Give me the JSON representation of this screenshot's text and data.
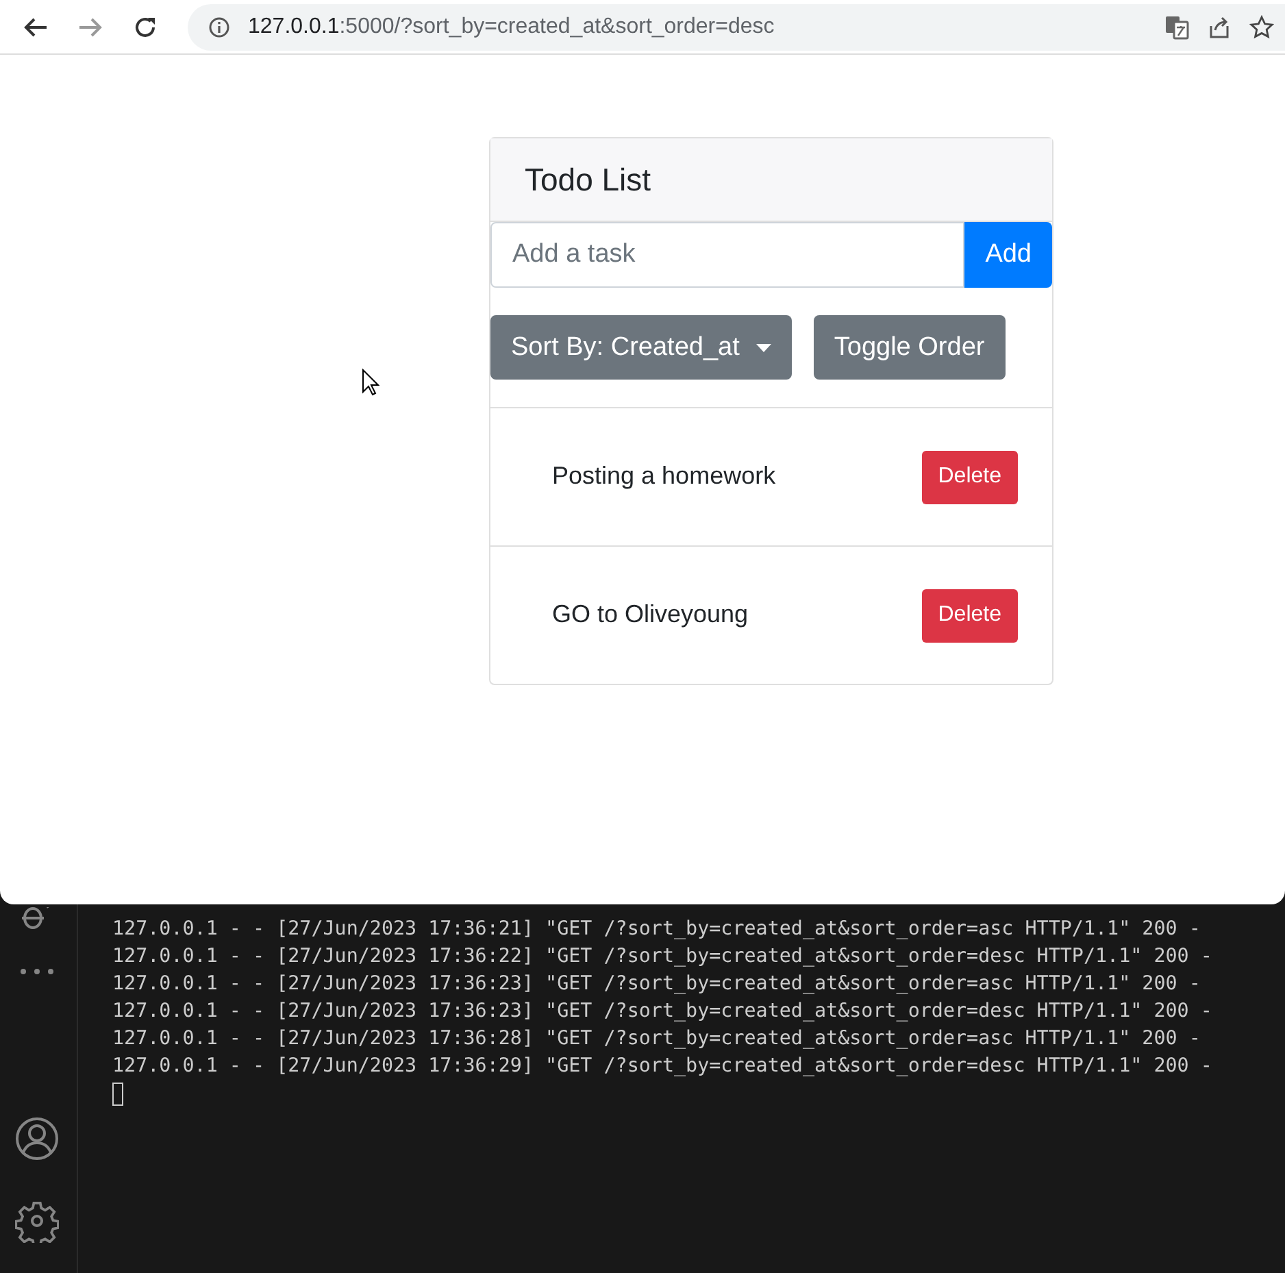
{
  "browser": {
    "url_host": "127.0.0.1",
    "url_rest": ":5000/?sort_by=created_at&sort_order=desc",
    "forward_disabled": true
  },
  "todo": {
    "title": "Todo List",
    "input": {
      "placeholder": "Add a task"
    },
    "add_button": "Add",
    "sort_button": "Sort By: Created_at",
    "toggle_button": "Toggle Order",
    "items": [
      {
        "text": "Posting a homework",
        "action": "Delete"
      },
      {
        "text": "GO to Oliveyoung",
        "action": "Delete"
      }
    ]
  },
  "terminal": {
    "lines": [
      "127.0.0.1 - - [27/Jun/2023 17:36:21] \"GET /?sort_by=created_at&sort_order=asc HTTP/1.1\" 200 -",
      "127.0.0.1 - - [27/Jun/2023 17:36:22] \"GET /?sort_by=created_at&sort_order=desc HTTP/1.1\" 200 -",
      "127.0.0.1 - - [27/Jun/2023 17:36:23] \"GET /?sort_by=created_at&sort_order=asc HTTP/1.1\" 200 -",
      "127.0.0.1 - - [27/Jun/2023 17:36:23] \"GET /?sort_by=created_at&sort_order=desc HTTP/1.1\" 200 -",
      "127.0.0.1 - - [27/Jun/2023 17:36:28] \"GET /?sort_by=created_at&sort_order=asc HTTP/1.1\" 200 -",
      "127.0.0.1 - - [27/Jun/2023 17:36:29] \"GET /?sort_by=created_at&sort_order=desc HTTP/1.1\" 200 -"
    ]
  }
}
